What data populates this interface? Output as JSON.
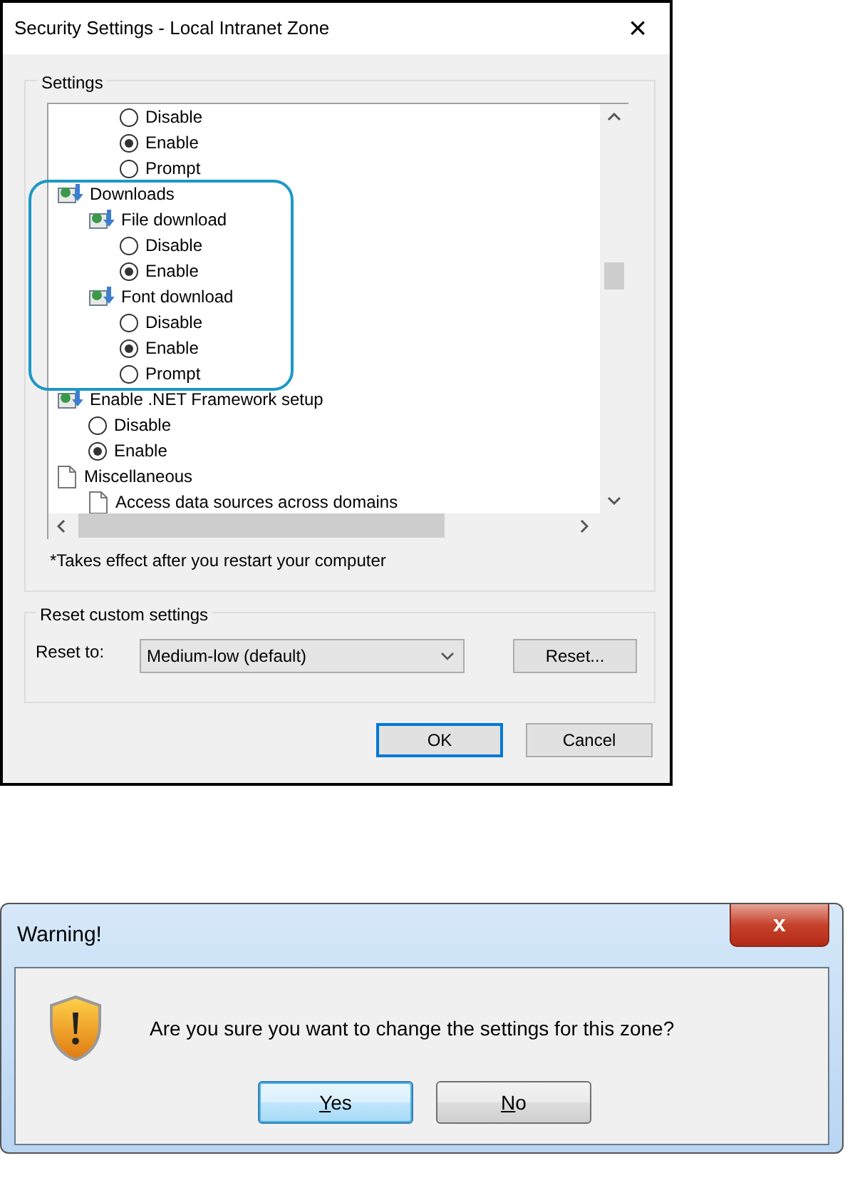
{
  "security_dialog": {
    "title": "Security Settings - Local Intranet Zone",
    "close": "×",
    "settings_group": {
      "label": "Settings",
      "tree": [
        {
          "children": [
            {
              "children": [
                {
                  "kind": "radio",
                  "label": "Disable",
                  "selected": false
                },
                {
                  "kind": "radio",
                  "label": "Enable",
                  "selected": true
                },
                {
                  "kind": "radio",
                  "label": "Prompt",
                  "selected": false
                }
              ]
            }
          ]
        },
        {
          "kind": "setting",
          "label": "Downloads",
          "highlighted": true,
          "children": [
            {
              "kind": "setting",
              "label": "File download",
              "children": [
                {
                  "kind": "radio",
                  "label": "Disable",
                  "selected": false
                },
                {
                  "kind": "radio",
                  "label": "Enable",
                  "selected": true
                }
              ]
            },
            {
              "kind": "setting",
              "label": "Font download",
              "children": [
                {
                  "kind": "radio",
                  "label": "Disable",
                  "selected": false
                },
                {
                  "kind": "radio",
                  "label": "Enable",
                  "selected": true
                },
                {
                  "kind": "radio",
                  "label": "Prompt",
                  "selected": false
                }
              ]
            }
          ]
        },
        {
          "kind": "setting",
          "label": "Enable .NET Framework setup",
          "highlighted": false,
          "children": [
            {
              "kind": "radio",
              "label": "Disable",
              "selected": false
            },
            {
              "kind": "radio",
              "label": "Enable",
              "selected": true
            }
          ]
        },
        {
          "kind": "category",
          "label": "Miscellaneous",
          "highlighted": false,
          "children": [
            {
              "kind": "category",
              "label": "Access data sources across domains"
            }
          ]
        }
      ],
      "footnote": "*Takes effect after you restart your computer"
    },
    "reset_group": {
      "label": "Reset custom settings",
      "reset_to_label": "Reset to:",
      "reset_to_value": "Medium-low (default)",
      "reset_button": "Reset..."
    },
    "buttons": [
      {
        "label": "OK",
        "default": true
      },
      {
        "label": "Cancel",
        "default": false
      }
    ]
  },
  "warning_dialog": {
    "title": "Warning!",
    "close": "x",
    "message": "Are you sure you want to change the settings for this zone?",
    "buttons": [
      {
        "label": "Yes",
        "default": true,
        "mnemonic": true
      },
      {
        "label": "No",
        "default": false,
        "mnemonic": true
      }
    ]
  }
}
